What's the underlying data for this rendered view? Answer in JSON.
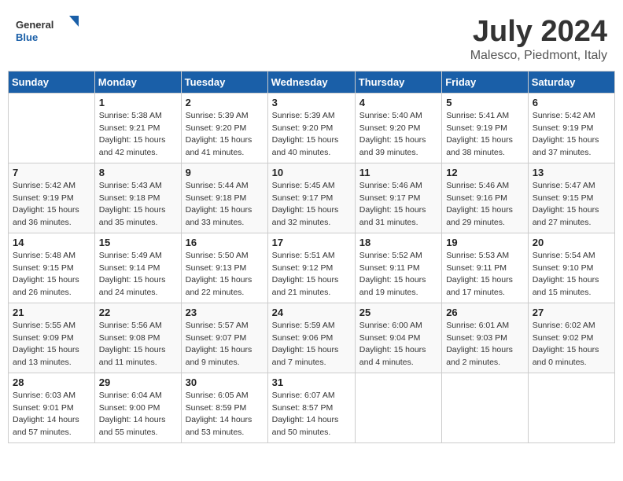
{
  "header": {
    "logo_general": "General",
    "logo_blue": "Blue",
    "month": "July 2024",
    "location": "Malesco, Piedmont, Italy"
  },
  "weekdays": [
    "Sunday",
    "Monday",
    "Tuesday",
    "Wednesday",
    "Thursday",
    "Friday",
    "Saturday"
  ],
  "weeks": [
    [
      {
        "day": "",
        "sunrise": "",
        "sunset": "",
        "daylight": ""
      },
      {
        "day": "1",
        "sunrise": "Sunrise: 5:38 AM",
        "sunset": "Sunset: 9:21 PM",
        "daylight": "Daylight: 15 hours and 42 minutes."
      },
      {
        "day": "2",
        "sunrise": "Sunrise: 5:39 AM",
        "sunset": "Sunset: 9:20 PM",
        "daylight": "Daylight: 15 hours and 41 minutes."
      },
      {
        "day": "3",
        "sunrise": "Sunrise: 5:39 AM",
        "sunset": "Sunset: 9:20 PM",
        "daylight": "Daylight: 15 hours and 40 minutes."
      },
      {
        "day": "4",
        "sunrise": "Sunrise: 5:40 AM",
        "sunset": "Sunset: 9:20 PM",
        "daylight": "Daylight: 15 hours and 39 minutes."
      },
      {
        "day": "5",
        "sunrise": "Sunrise: 5:41 AM",
        "sunset": "Sunset: 9:19 PM",
        "daylight": "Daylight: 15 hours and 38 minutes."
      },
      {
        "day": "6",
        "sunrise": "Sunrise: 5:42 AM",
        "sunset": "Sunset: 9:19 PM",
        "daylight": "Daylight: 15 hours and 37 minutes."
      }
    ],
    [
      {
        "day": "7",
        "sunrise": "Sunrise: 5:42 AM",
        "sunset": "Sunset: 9:19 PM",
        "daylight": "Daylight: 15 hours and 36 minutes."
      },
      {
        "day": "8",
        "sunrise": "Sunrise: 5:43 AM",
        "sunset": "Sunset: 9:18 PM",
        "daylight": "Daylight: 15 hours and 35 minutes."
      },
      {
        "day": "9",
        "sunrise": "Sunrise: 5:44 AM",
        "sunset": "Sunset: 9:18 PM",
        "daylight": "Daylight: 15 hours and 33 minutes."
      },
      {
        "day": "10",
        "sunrise": "Sunrise: 5:45 AM",
        "sunset": "Sunset: 9:17 PM",
        "daylight": "Daylight: 15 hours and 32 minutes."
      },
      {
        "day": "11",
        "sunrise": "Sunrise: 5:46 AM",
        "sunset": "Sunset: 9:17 PM",
        "daylight": "Daylight: 15 hours and 31 minutes."
      },
      {
        "day": "12",
        "sunrise": "Sunrise: 5:46 AM",
        "sunset": "Sunset: 9:16 PM",
        "daylight": "Daylight: 15 hours and 29 minutes."
      },
      {
        "day": "13",
        "sunrise": "Sunrise: 5:47 AM",
        "sunset": "Sunset: 9:15 PM",
        "daylight": "Daylight: 15 hours and 27 minutes."
      }
    ],
    [
      {
        "day": "14",
        "sunrise": "Sunrise: 5:48 AM",
        "sunset": "Sunset: 9:15 PM",
        "daylight": "Daylight: 15 hours and 26 minutes."
      },
      {
        "day": "15",
        "sunrise": "Sunrise: 5:49 AM",
        "sunset": "Sunset: 9:14 PM",
        "daylight": "Daylight: 15 hours and 24 minutes."
      },
      {
        "day": "16",
        "sunrise": "Sunrise: 5:50 AM",
        "sunset": "Sunset: 9:13 PM",
        "daylight": "Daylight: 15 hours and 22 minutes."
      },
      {
        "day": "17",
        "sunrise": "Sunrise: 5:51 AM",
        "sunset": "Sunset: 9:12 PM",
        "daylight": "Daylight: 15 hours and 21 minutes."
      },
      {
        "day": "18",
        "sunrise": "Sunrise: 5:52 AM",
        "sunset": "Sunset: 9:11 PM",
        "daylight": "Daylight: 15 hours and 19 minutes."
      },
      {
        "day": "19",
        "sunrise": "Sunrise: 5:53 AM",
        "sunset": "Sunset: 9:11 PM",
        "daylight": "Daylight: 15 hours and 17 minutes."
      },
      {
        "day": "20",
        "sunrise": "Sunrise: 5:54 AM",
        "sunset": "Sunset: 9:10 PM",
        "daylight": "Daylight: 15 hours and 15 minutes."
      }
    ],
    [
      {
        "day": "21",
        "sunrise": "Sunrise: 5:55 AM",
        "sunset": "Sunset: 9:09 PM",
        "daylight": "Daylight: 15 hours and 13 minutes."
      },
      {
        "day": "22",
        "sunrise": "Sunrise: 5:56 AM",
        "sunset": "Sunset: 9:08 PM",
        "daylight": "Daylight: 15 hours and 11 minutes."
      },
      {
        "day": "23",
        "sunrise": "Sunrise: 5:57 AM",
        "sunset": "Sunset: 9:07 PM",
        "daylight": "Daylight: 15 hours and 9 minutes."
      },
      {
        "day": "24",
        "sunrise": "Sunrise: 5:59 AM",
        "sunset": "Sunset: 9:06 PM",
        "daylight": "Daylight: 15 hours and 7 minutes."
      },
      {
        "day": "25",
        "sunrise": "Sunrise: 6:00 AM",
        "sunset": "Sunset: 9:04 PM",
        "daylight": "Daylight: 15 hours and 4 minutes."
      },
      {
        "day": "26",
        "sunrise": "Sunrise: 6:01 AM",
        "sunset": "Sunset: 9:03 PM",
        "daylight": "Daylight: 15 hours and 2 minutes."
      },
      {
        "day": "27",
        "sunrise": "Sunrise: 6:02 AM",
        "sunset": "Sunset: 9:02 PM",
        "daylight": "Daylight: 15 hours and 0 minutes."
      }
    ],
    [
      {
        "day": "28",
        "sunrise": "Sunrise: 6:03 AM",
        "sunset": "Sunset: 9:01 PM",
        "daylight": "Daylight: 14 hours and 57 minutes."
      },
      {
        "day": "29",
        "sunrise": "Sunrise: 6:04 AM",
        "sunset": "Sunset: 9:00 PM",
        "daylight": "Daylight: 14 hours and 55 minutes."
      },
      {
        "day": "30",
        "sunrise": "Sunrise: 6:05 AM",
        "sunset": "Sunset: 8:59 PM",
        "daylight": "Daylight: 14 hours and 53 minutes."
      },
      {
        "day": "31",
        "sunrise": "Sunrise: 6:07 AM",
        "sunset": "Sunset: 8:57 PM",
        "daylight": "Daylight: 14 hours and 50 minutes."
      },
      {
        "day": "",
        "sunrise": "",
        "sunset": "",
        "daylight": ""
      },
      {
        "day": "",
        "sunrise": "",
        "sunset": "",
        "daylight": ""
      },
      {
        "day": "",
        "sunrise": "",
        "sunset": "",
        "daylight": ""
      }
    ]
  ]
}
